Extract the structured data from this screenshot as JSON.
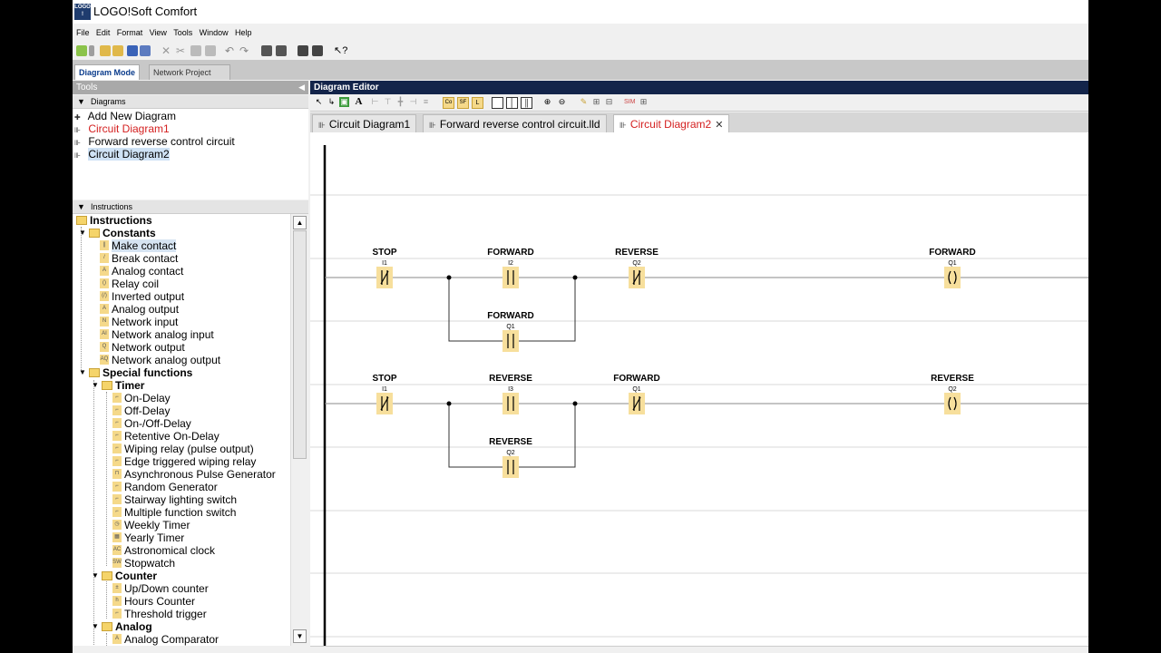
{
  "app": {
    "title": "LOGO!Soft Comfort",
    "logo_text": "LOGO!"
  },
  "menu": [
    "File",
    "Edit",
    "Format",
    "View",
    "Tools",
    "Window",
    "Help"
  ],
  "mode_tabs": {
    "active": "Diagram Mode",
    "inactive": "Network Project"
  },
  "tools": {
    "header": "Tools",
    "diagrams_header": "Diagrams",
    "diagrams": [
      {
        "label": "Add New Diagram",
        "icon": "add-icon",
        "state": "normal"
      },
      {
        "label": "Circuit Diagram1",
        "icon": "ladder-icon",
        "state": "red"
      },
      {
        "label": "Forward reverse control circuit",
        "icon": "ladder-icon",
        "state": "normal"
      },
      {
        "label": "Circuit Diagram2",
        "icon": "ladder-icon",
        "state": "selected"
      }
    ],
    "instructions_header": "Instructions"
  },
  "instructions": {
    "root": "Instructions",
    "constants": {
      "label": "Constants",
      "items": [
        "Make contact",
        "Break contact",
        "Analog contact",
        "Relay coil",
        "Inverted output",
        "Analog output",
        "Network input",
        "Network analog input",
        "Network output",
        "Network analog output"
      ]
    },
    "special": {
      "label": "Special functions",
      "timer": {
        "label": "Timer",
        "items": [
          "On-Delay",
          "Off-Delay",
          "On-/Off-Delay",
          "Retentive On-Delay",
          "Wiping relay (pulse output)",
          "Edge triggered wiping relay",
          "Asynchronous Pulse Generator",
          "Random Generator",
          "Stairway lighting switch",
          "Multiple function switch",
          "Weekly Timer",
          "Yearly Timer",
          "Astronomical clock",
          "Stopwatch"
        ]
      },
      "counter": {
        "label": "Counter",
        "items": [
          "Up/Down counter",
          "Hours Counter",
          "Threshold trigger"
        ]
      },
      "analog": {
        "label": "Analog",
        "items": [
          "Analog Comparator"
        ]
      }
    }
  },
  "editor": {
    "header": "Diagram Editor",
    "tabs": [
      "Circuit Diagram1",
      "Forward reverse control circuit.lld",
      "Circuit Diagram2"
    ],
    "active_tab": "Circuit Diagram2",
    "rungs": [
      {
        "elements": [
          {
            "name": "STOP",
            "addr": "I1",
            "type": "nc"
          },
          {
            "name": "FORWARD",
            "addr": "I2",
            "type": "no"
          },
          {
            "name": "REVERSE",
            "addr": "Q2",
            "type": "nc"
          },
          {
            "name": "FORWARD",
            "addr": "Q1",
            "type": "coil"
          }
        ],
        "parallel": {
          "name": "FORWARD",
          "addr": "Q1",
          "type": "no"
        }
      },
      {
        "elements": [
          {
            "name": "STOP",
            "addr": "I1",
            "type": "nc"
          },
          {
            "name": "REVERSE",
            "addr": "I3",
            "type": "no"
          },
          {
            "name": "FORWARD",
            "addr": "Q1",
            "type": "nc"
          },
          {
            "name": "REVERSE",
            "addr": "Q2",
            "type": "coil"
          }
        ],
        "parallel": {
          "name": "REVERSE",
          "addr": "Q2",
          "type": "no"
        }
      }
    ]
  },
  "colors": {
    "contact_fill": "#f7df9c",
    "wire": "#8a8a8a",
    "editor_header": "#13244a",
    "active_tab_text": "#d42020"
  }
}
